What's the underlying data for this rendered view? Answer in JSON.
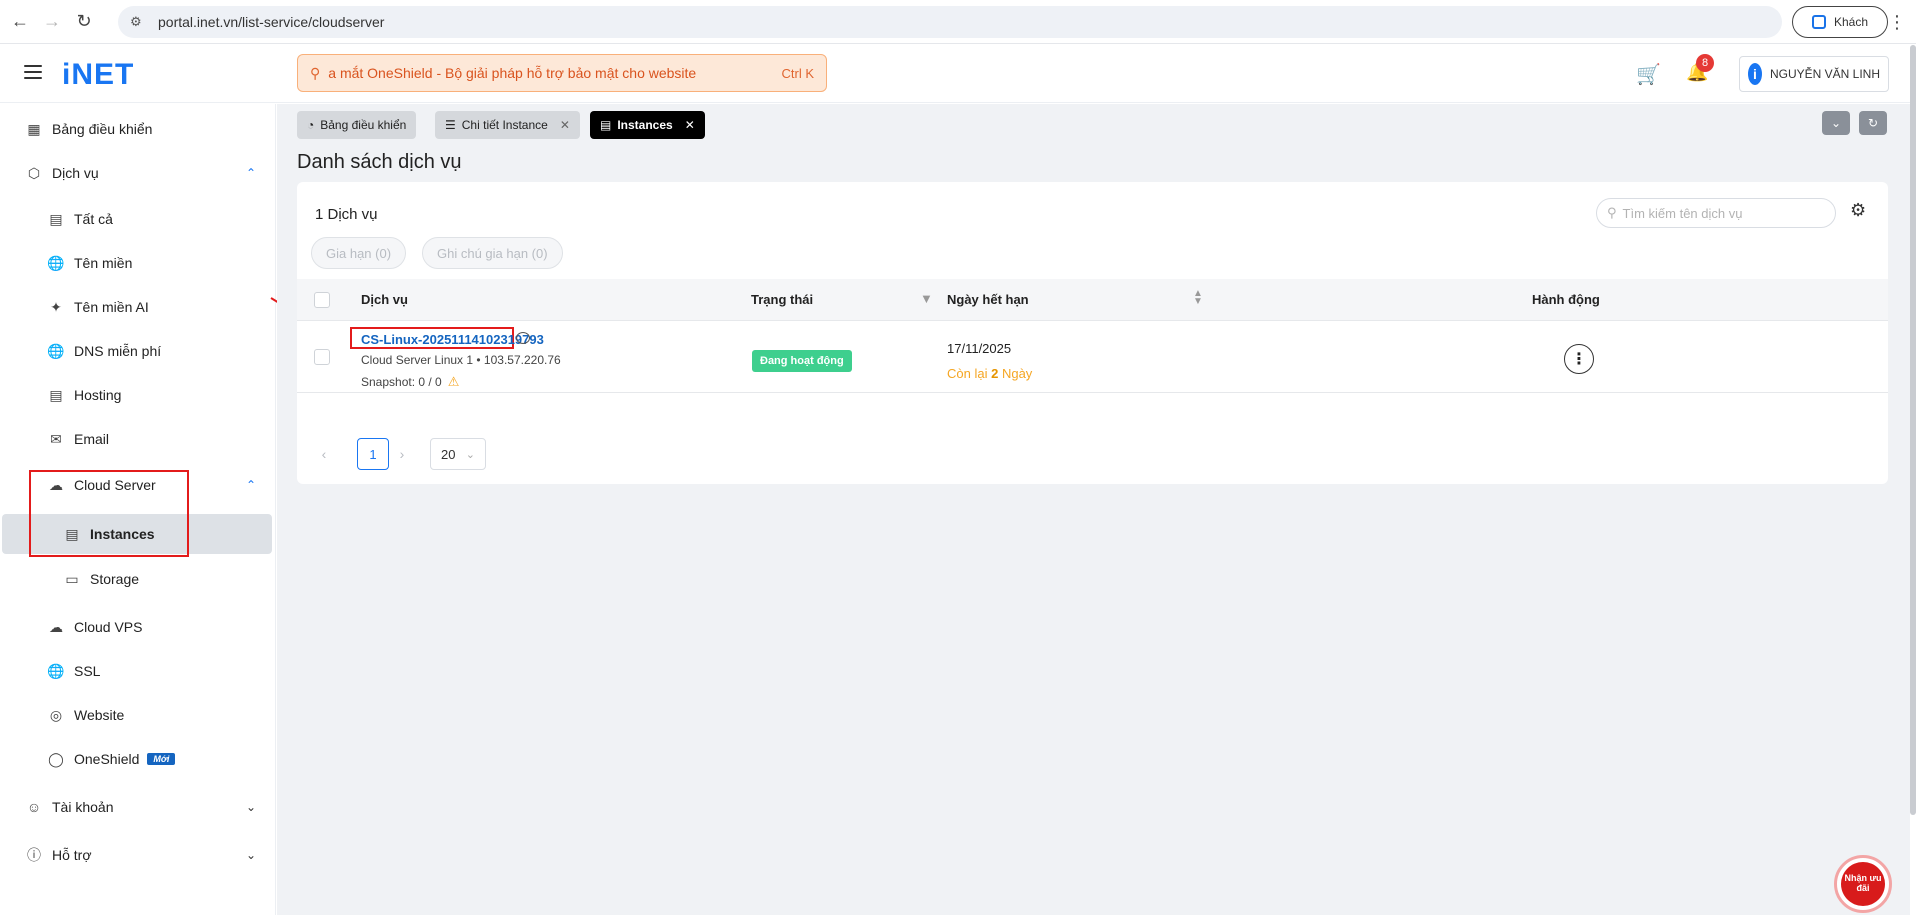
{
  "browser": {
    "url": "portal.inet.vn/list-service/cloudserver",
    "profile_label": "Khách"
  },
  "header": {
    "logo": "iNET",
    "search_text": "a mắt OneShield - Bộ giải pháp hỗ trợ bảo mật cho website",
    "search_shortcut": "Ctrl K",
    "notification_count": "8",
    "user_name": "NGUYỄN VĂN LINH",
    "user_avatar_letter": "i"
  },
  "sidebar": {
    "dashboard": "Bảng điều khiển",
    "services": "Dịch vụ",
    "all": "Tất cả",
    "domains": "Tên miền",
    "ai_domains": "Tên miền AI",
    "free_dns": "DNS miễn phí",
    "hosting": "Hosting",
    "email": "Email",
    "cloud_server": "Cloud Server",
    "instances": "Instances",
    "storage": "Storage",
    "cloud_vps": "Cloud VPS",
    "ssl": "SSL",
    "website": "Website",
    "oneshield": "OneShield",
    "new_badge": "Mới",
    "account": "Tài khoản",
    "support": "Hỗ trợ"
  },
  "tabs": [
    {
      "label": "Bảng điều khiển"
    },
    {
      "label": "Chi tiết Instance"
    },
    {
      "label": "Instances"
    }
  ],
  "main": {
    "title": "Danh sách dịch vụ",
    "count": "1 Dịch vụ",
    "search_placeholder": "Tìm kiếm tên dịch vụ",
    "filter_renew": "Gia hạn (0)",
    "filter_renew_note": "Ghi chú gia hạn (0)",
    "columns": {
      "service": "Dịch vụ",
      "status": "Trạng thái",
      "expiry": "Ngày hết hạn",
      "actions": "Hành động"
    },
    "rows": [
      {
        "name": "CS-Linux-20251114102319793",
        "subtitle": "Cloud Server Linux 1  •  103.57.220.76",
        "snapshot": "Snapshot: 0 / 0",
        "status": "Đang hoạt động",
        "expiry": "17/11/2025",
        "remaining_prefix": "Còn lại",
        "remaining_days": "2",
        "remaining_suffix": "Ngày"
      }
    ],
    "pagination": {
      "current_page": "1",
      "page_size": "20"
    }
  },
  "offer": {
    "label": "Nhận ưu đãi"
  },
  "colors": {
    "brand": "#1976f2",
    "status_active": "#3ecf8e",
    "annotation": "#e31b1b"
  }
}
